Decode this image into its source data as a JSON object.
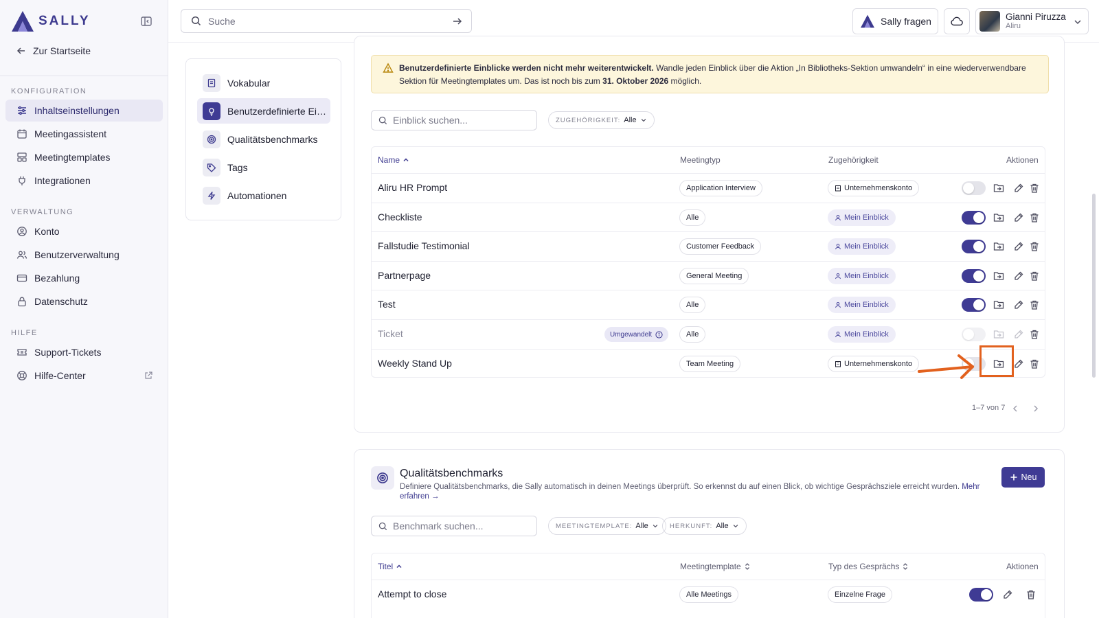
{
  "brand": {
    "name": "SALLY"
  },
  "sidebar": {
    "back_label": "Zur Startseite",
    "sections": [
      {
        "title": "KONFIGURATION",
        "items": [
          {
            "label": "Inhaltseinstellungen",
            "icon": "sliders-icon",
            "active": true
          },
          {
            "label": "Meetingassistent",
            "icon": "calendar-icon"
          },
          {
            "label": "Meetingtemplates",
            "icon": "templates-icon"
          },
          {
            "label": "Integrationen",
            "icon": "plug-icon"
          }
        ]
      },
      {
        "title": "VERWALTUNG",
        "items": [
          {
            "label": "Konto",
            "icon": "user-circle-icon"
          },
          {
            "label": "Benutzerverwaltung",
            "icon": "users-icon"
          },
          {
            "label": "Bezahlung",
            "icon": "credit-card-icon"
          },
          {
            "label": "Datenschutz",
            "icon": "lock-icon"
          }
        ]
      },
      {
        "title": "HILFE",
        "items": [
          {
            "label": "Support-Tickets",
            "icon": "ticket-icon"
          },
          {
            "label": "Hilfe-Center",
            "icon": "lifebuoy-icon"
          }
        ]
      }
    ]
  },
  "topbar": {
    "search_placeholder": "Suche",
    "ask_label": "Sally fragen",
    "user_name": "Gianni Piruzza",
    "user_org": "Aliru"
  },
  "subnav": {
    "items": [
      {
        "label": "Vokabular"
      },
      {
        "label": "Benutzerdefinierte Einblicke",
        "active": true
      },
      {
        "label": "Qualitätsbenchmarks"
      },
      {
        "label": "Tags"
      },
      {
        "label": "Automationen"
      }
    ]
  },
  "insights": {
    "notice_bold": "Benutzerdefinierte Einblicke werden nicht mehr weiterentwickelt.",
    "notice_text": " Wandle jeden Einblick über die Aktion „In Bibliotheks-Sektion umwandeln“ in eine wiederverwendbare Sektion für Meetingtemplates um. Das ist noch bis zum ",
    "notice_date": "31. Oktober 2026",
    "notice_end": " möglich.",
    "search_placeholder": "Einblick suchen...",
    "filter_label": "ZUGEHÖRIGKEIT:",
    "filter_value": "Alle",
    "columns": {
      "name": "Name",
      "type": "Meetingtyp",
      "owner": "Zugehörigkeit",
      "actions": "Aktionen"
    },
    "rows": [
      {
        "name": "Aliru HR Prompt",
        "type": "Application Interview",
        "owner": "Unternehmenskonto",
        "owner_kind": "company",
        "enabled": false
      },
      {
        "name": "Checkliste",
        "type": "Alle",
        "owner": "Mein Einblick",
        "owner_kind": "mine",
        "enabled": true
      },
      {
        "name": "Fallstudie Testimonial",
        "type": "Customer Feedback",
        "owner": "Mein Einblick",
        "owner_kind": "mine",
        "enabled": true
      },
      {
        "name": "Partnerpage",
        "type": "General Meeting",
        "owner": "Mein Einblick",
        "owner_kind": "mine",
        "enabled": true
      },
      {
        "name": "Test",
        "type": "Alle",
        "owner": "Mein Einblick",
        "owner_kind": "mine",
        "enabled": true
      },
      {
        "name": "Ticket",
        "type": "Alle",
        "owner": "Mein Einblick",
        "owner_kind": "mine",
        "enabled": false,
        "converted": true,
        "badge": "Umgewandelt"
      },
      {
        "name": "Weekly Stand Up",
        "type": "Team Meeting",
        "owner": "Unternehmenskonto",
        "owner_kind": "company",
        "enabled": false
      }
    ],
    "pagination": "1–7 von 7"
  },
  "benchmarks": {
    "title": "Qualitätsbenchmarks",
    "description": "Definiere Qualitätsbenchmarks, die Sally automatisch in deinen Meetings überprüft. So erkennst du auf einen Blick, ob wichtige Gesprächsziele erreicht wurden.",
    "more_link": "Mehr erfahren →",
    "new_label": "Neu",
    "search_placeholder": "Benchmark suchen...",
    "filter1_label": "MEETINGTEMPLATE:",
    "filter1_value": "Alle",
    "filter2_label": "HERKUNFT:",
    "filter2_value": "Alle",
    "columns": {
      "title": "Titel",
      "template": "Meetingtemplate",
      "type": "Typ des Gesprächs",
      "actions": "Aktionen"
    },
    "rows": [
      {
        "title": "Attempt to close",
        "template": "Alle Meetings",
        "type": "Einzelne Frage",
        "enabled": true
      }
    ]
  },
  "colors": {
    "accent": "#3f3b94",
    "highlight": "#e2611e",
    "notice_bg": "#fdf6dc"
  }
}
